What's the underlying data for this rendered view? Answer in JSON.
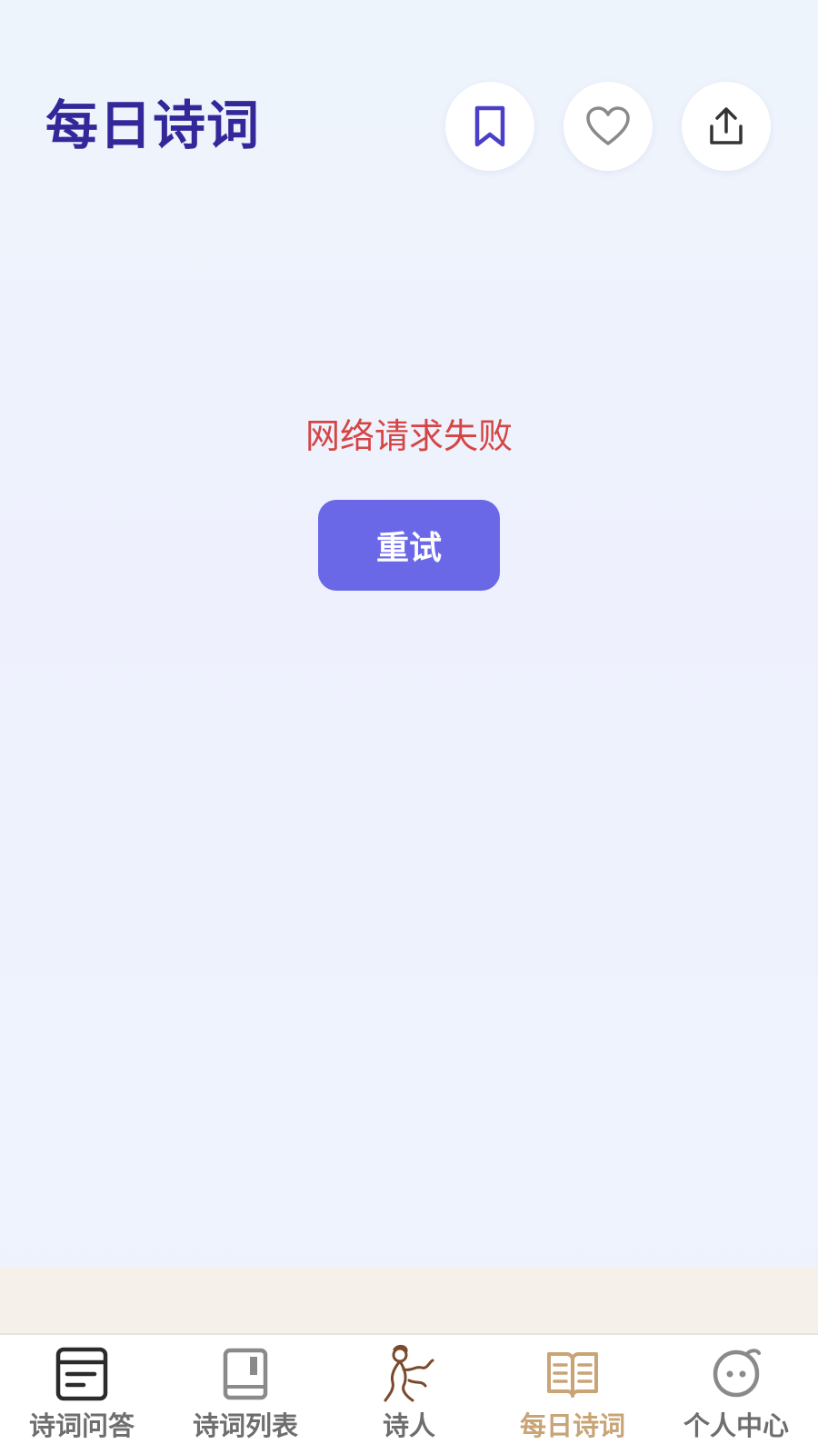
{
  "header": {
    "title": "每日诗词",
    "actions": [
      {
        "icon": "bookmark-icon",
        "color": "#4a3fc6"
      },
      {
        "icon": "heart-icon",
        "color": "#8a8a8a"
      },
      {
        "icon": "share-icon",
        "color": "#333333"
      }
    ]
  },
  "main": {
    "error_message": "网络请求失败",
    "retry_label": "重试"
  },
  "tabbar": {
    "active_index": 3,
    "active_color": "#c8a476",
    "items": [
      {
        "label": "诗词问答",
        "icon": "poetry-qa-icon"
      },
      {
        "label": "诗词列表",
        "icon": "book-list-icon"
      },
      {
        "label": "诗人",
        "icon": "poet-icon"
      },
      {
        "label": "每日诗词",
        "icon": "open-book-icon"
      },
      {
        "label": "个人中心",
        "icon": "profile-face-icon"
      }
    ]
  },
  "colors": {
    "title": "#33279a",
    "error": "#d64545",
    "retry_button": "#6b68e8",
    "tab_inactive": "#6e6e6e"
  }
}
